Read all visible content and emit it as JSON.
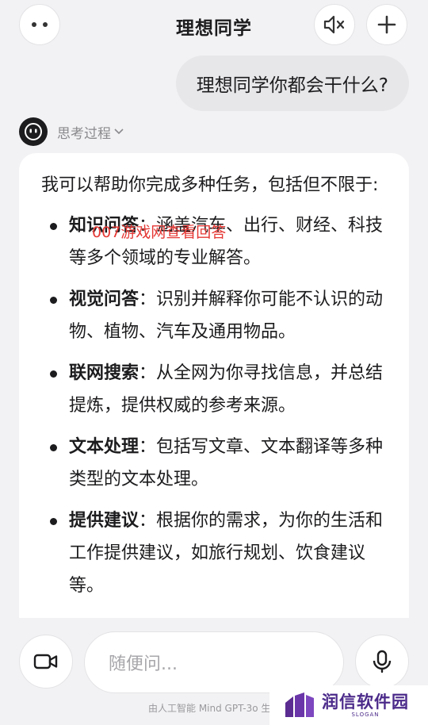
{
  "header": {
    "title": "理想同学",
    "more_icon": "more-dots-icon",
    "mute_icon": "speaker-muted-icon",
    "add_icon": "plus-icon"
  },
  "chat": {
    "user_message": "理想同学你都会干什么?",
    "thinking_label": "思考过程",
    "answer": {
      "intro": "我可以帮助你完成多种任务，包括但不限于:",
      "items": [
        {
          "title": "知识问答",
          "desc": "涵盖汽车、出行、财经、科技等多个领域的专业解答。"
        },
        {
          "title": "视觉问答",
          "desc": "识别并解释你可能不认识的动物、植物、汽车及通用物品。"
        },
        {
          "title": "联网搜索",
          "desc": "从全网为你寻找信息，并总结提炼，提供权威的参考来源。"
        },
        {
          "title": "文本处理",
          "desc": "包括写文章、文本翻译等多种类型的文本处理。"
        },
        {
          "title": "提供建议",
          "desc": "根据你的需求，为你的生活和工作提供建议，如旅行规划、饮食建议等。"
        }
      ]
    },
    "watermark": "007游戏网查看回答"
  },
  "composer": {
    "placeholder": "随便问...",
    "video_icon": "video-camera-icon",
    "mic_icon": "microphone-icon"
  },
  "footer": {
    "disclaimer": "由人工智能 Mind GPT-3o 生"
  },
  "brand": {
    "name": "润信软件园",
    "slogan": "SLOGAN"
  }
}
